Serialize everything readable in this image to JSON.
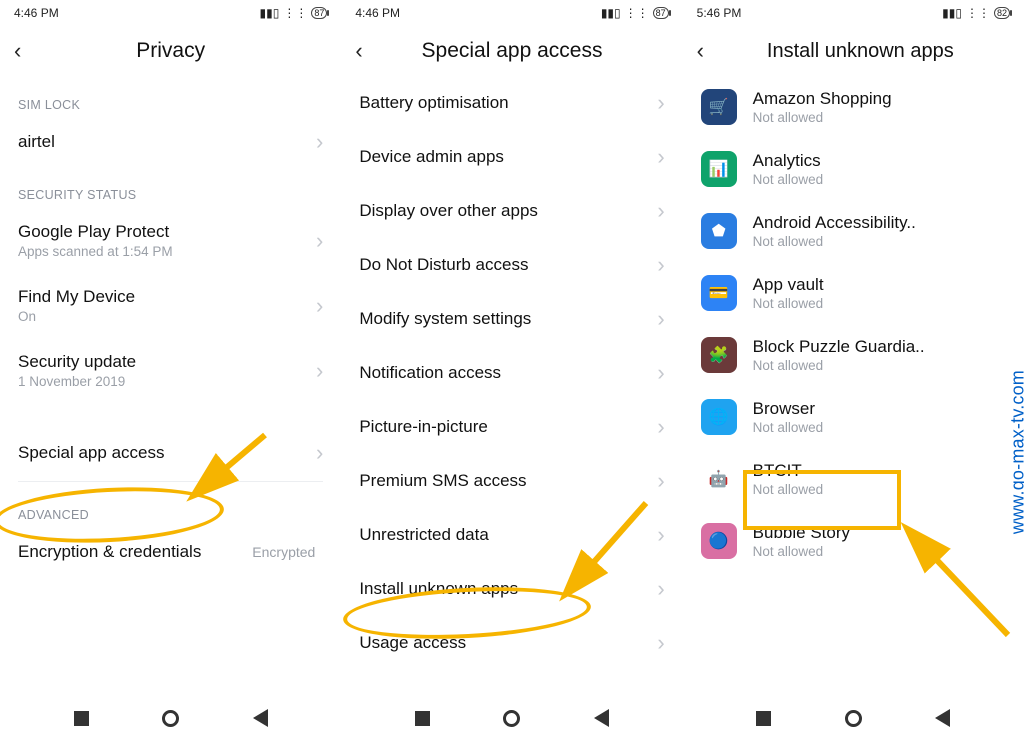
{
  "watermark": "www.go-max-tv.com",
  "screen1": {
    "time": "4:46 PM",
    "battery": "87",
    "title": "Privacy",
    "sections": {
      "sim_lock_label": "SIM LOCK",
      "airtel": "airtel",
      "security_status_label": "SECURITY STATUS",
      "gpp_title": "Google Play Protect",
      "gpp_sub": "Apps scanned at 1:54 PM",
      "fmd_title": "Find My Device",
      "fmd_sub": "On",
      "secupd_title": "Security update",
      "secupd_sub": "1 November 2019",
      "special_title": "Special app access",
      "advanced_label": "ADVANCED",
      "enc_title": "Encryption & credentials",
      "enc_trailing": "Encrypted"
    }
  },
  "screen2": {
    "time": "4:46 PM",
    "battery": "87",
    "title": "Special app access",
    "items": [
      "Battery optimisation",
      "Device admin apps",
      "Display over other apps",
      "Do Not Disturb access",
      "Modify system settings",
      "Notification access",
      "Picture-in-picture",
      "Premium SMS access",
      "Unrestricted data",
      "Install unknown apps",
      "Usage access"
    ]
  },
  "screen3": {
    "time": "5:46 PM",
    "battery": "82",
    "title": "Install unknown apps",
    "not_allowed": "Not allowed",
    "apps": [
      {
        "name": "Amazon Shopping",
        "color": "#22457a",
        "glyph": "🛒"
      },
      {
        "name": "Analytics",
        "color": "#0fa36b",
        "glyph": "📊"
      },
      {
        "name": "Android Accessibility..",
        "color": "#2a7de1",
        "glyph": "⬟"
      },
      {
        "name": "App vault",
        "color": "#2d83f5",
        "glyph": "💳"
      },
      {
        "name": "Block Puzzle Guardia..",
        "color": "#6b3a3a",
        "glyph": "🧩"
      },
      {
        "name": "Browser",
        "color": "#1fa3f0",
        "glyph": "🌐"
      },
      {
        "name": "BTCIT",
        "color": "#ffffff",
        "glyph": "🤖"
      },
      {
        "name": "Bubble Story",
        "color": "#d96fa3",
        "glyph": "🔵"
      }
    ]
  }
}
